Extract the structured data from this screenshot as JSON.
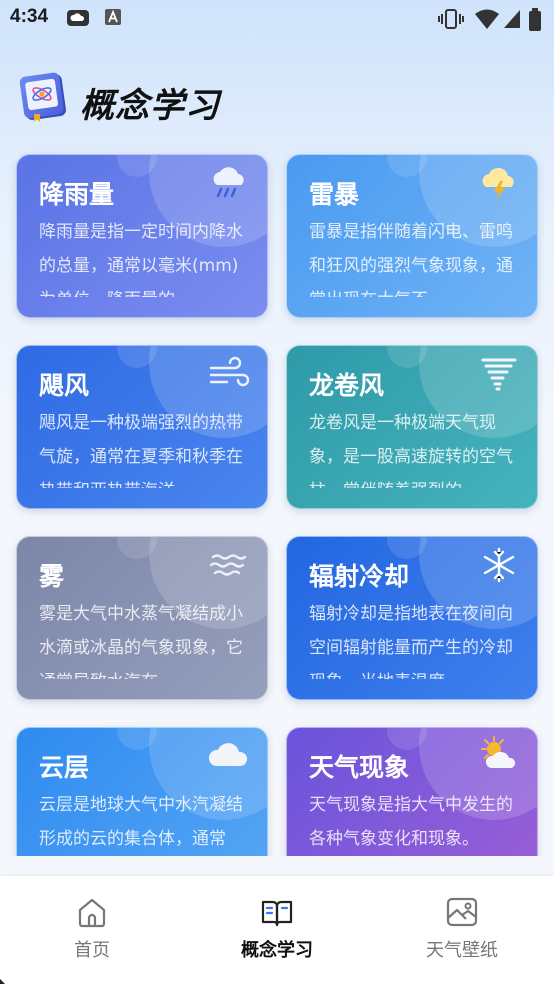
{
  "status_bar": {
    "time": "4:34"
  },
  "header": {
    "title": "概念学习",
    "logo_icon": "book-atom-icon"
  },
  "cards": [
    {
      "title": "降雨量",
      "desc": "降雨量是指一定时间内降水的总量，通常以毫米(mm)为单位。降雨量的",
      "icon": "rain-cloud-icon",
      "gradient": [
        "#5a74e6",
        "#7b8df0"
      ]
    },
    {
      "title": "雷暴",
      "desc": "雷暴是指伴随着闪电、雷鸣和狂风的强烈气象现象，通常出现在大气不",
      "icon": "thunderstorm-icon",
      "gradient": [
        "#4a9af0",
        "#6fb3f6"
      ]
    },
    {
      "title": "飓风",
      "desc": "飓风是一种极端强烈的热带气旋，通常在夏季和秋季在热带和亚热带海洋",
      "icon": "wind-icon",
      "gradient": [
        "#2f6ae4",
        "#4a86ef"
      ]
    },
    {
      "title": "龙卷风",
      "desc": "龙卷风是一种极端天气现象，是一股高速旋转的空气柱，常伴随着强烈的",
      "icon": "tornado-icon",
      "gradient": [
        "#2f9aa8",
        "#45b3bd"
      ]
    },
    {
      "title": "雾",
      "desc": "雾是大气中水蒸气凝结成小水滴或冰晶的气象现象，它通常导致水汽在",
      "icon": "fog-icon",
      "gradient": [
        "#7c86a8",
        "#969fbc"
      ]
    },
    {
      "title": "辐射冷却",
      "desc": "辐射冷却是指地表在夜间向空间辐射能量而产生的冷却现象，当地表温度",
      "icon": "snowflake-icon",
      "gradient": [
        "#2366e0",
        "#3f80ee"
      ]
    },
    {
      "title": "云层",
      "desc": "云层是地球大气中水汽凝结形成的云的集合体，通常",
      "icon": "cloud-icon",
      "gradient": [
        "#2f8bf0",
        "#56a6f4"
      ]
    },
    {
      "title": "天气现象",
      "desc": "天气现象是指大气中发生的各种气象变化和现象。",
      "icon": "sun-cloud-icon",
      "gradient": [
        "#6a54dc",
        "#9b5fd6"
      ]
    }
  ],
  "nav": {
    "items": [
      {
        "label": "首页",
        "icon": "home-icon",
        "active": false
      },
      {
        "label": "概念学习",
        "icon": "book-open-icon",
        "active": true
      },
      {
        "label": "天气壁纸",
        "icon": "wallpaper-icon",
        "active": false
      }
    ]
  },
  "colors": {
    "nav_active": "#111111",
    "nav_inactive": "#777777"
  }
}
